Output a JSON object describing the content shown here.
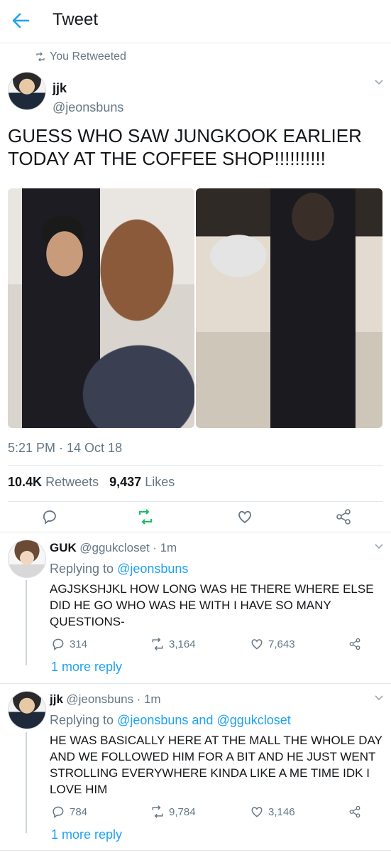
{
  "header": {
    "title": "Tweet"
  },
  "retweet_banner": "You Retweeted",
  "tweet": {
    "name": "jjk",
    "handle": "@jeonsbuns",
    "text": "GUESS WHO SAW JUNGKOOK EARLIER TODAY AT THE COFFEE SHOP!!!!!!!!!!",
    "timestamp": "5:21 PM · 14 Oct 18",
    "retweets_count": "10.4K",
    "retweets_label": "Retweets",
    "likes_count": "9,437",
    "likes_label": "Likes"
  },
  "replies": [
    {
      "name": "GUK",
      "handle": "@ggukcloset",
      "age": "· 1m",
      "replying_prefix": "Replying to",
      "replying_to": "@jeonsbuns",
      "text": "AGJSKSHJKL HOW LONG WAS HE THERE WHERE ELSE DID HE GO WHO WAS HE WITH I HAVE SO MANY QUESTIONS-",
      "reply_count": "314",
      "retweet_count": "3,164",
      "like_count": "7,643",
      "more": "1 more reply"
    },
    {
      "name": "jjk",
      "handle": "@jeonsbuns",
      "age": "· 1m",
      "replying_prefix": "Replying to",
      "replying_to": "@jeonsbuns and @ggukcloset",
      "text": "HE WAS BASICALLY HERE AT THE MALL THE WHOLE DAY AND WE FOLLOWED HIM FOR A BIT AND HE JUST WENT STROLLING EVERYWHERE KINDA LIKE A ME TIME IDK I LOVE HIM",
      "reply_count": "784",
      "retweet_count": "9,784",
      "like_count": "3,146",
      "more": "1 more reply"
    }
  ],
  "colors": {
    "accent": "#1da1f2",
    "retweet_green": "#17bf63",
    "muted": "#657786",
    "divider": "#e1e8ed"
  },
  "icons": [
    "back-arrow-icon",
    "retweet-icon",
    "reply-icon",
    "heart-icon",
    "share-icon",
    "chevron-down-icon"
  ]
}
